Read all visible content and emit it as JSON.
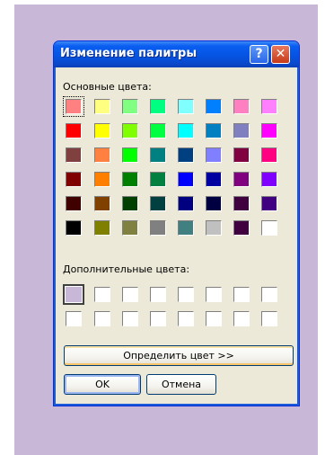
{
  "window": {
    "title": "Изменение палитры",
    "help_glyph": "?",
    "close_glyph": "✕"
  },
  "labels": {
    "basic_colors": "Основные цвета:",
    "custom_colors": "Дополнительные цвета:"
  },
  "basic_colors": [
    [
      "#ff8080",
      "#ffff80",
      "#80ff80",
      "#00ff80",
      "#80ffff",
      "#0080ff",
      "#ff80c0",
      "#ff80ff"
    ],
    [
      "#ff0000",
      "#ffff00",
      "#80ff00",
      "#00ff40",
      "#00ffff",
      "#0080c0",
      "#8080c0",
      "#ff00ff"
    ],
    [
      "#804040",
      "#ff8040",
      "#00ff00",
      "#008080",
      "#004080",
      "#8080ff",
      "#800040",
      "#ff0080"
    ],
    [
      "#800000",
      "#ff8000",
      "#008000",
      "#008040",
      "#0000ff",
      "#0000a0",
      "#800080",
      "#8000ff"
    ],
    [
      "#400000",
      "#804000",
      "#004000",
      "#004040",
      "#000080",
      "#000040",
      "#400040",
      "#400080"
    ],
    [
      "#000000",
      "#808000",
      "#808040",
      "#808080",
      "#408080",
      "#c0c0c0",
      "#400040",
      "#ffffff"
    ]
  ],
  "selected_basic": [
    0,
    0
  ],
  "custom_colors": [
    [
      "#c9b7d8",
      "#ffffff",
      "#ffffff",
      "#ffffff",
      "#ffffff",
      "#ffffff",
      "#ffffff",
      "#ffffff"
    ],
    [
      "#ffffff",
      "#ffffff",
      "#ffffff",
      "#ffffff",
      "#ffffff",
      "#ffffff",
      "#ffffff",
      "#ffffff"
    ]
  ],
  "selected_custom": [
    0,
    0
  ],
  "buttons": {
    "define_custom": "Определить цвет >>",
    "ok": "OK",
    "cancel": "Отмена"
  }
}
